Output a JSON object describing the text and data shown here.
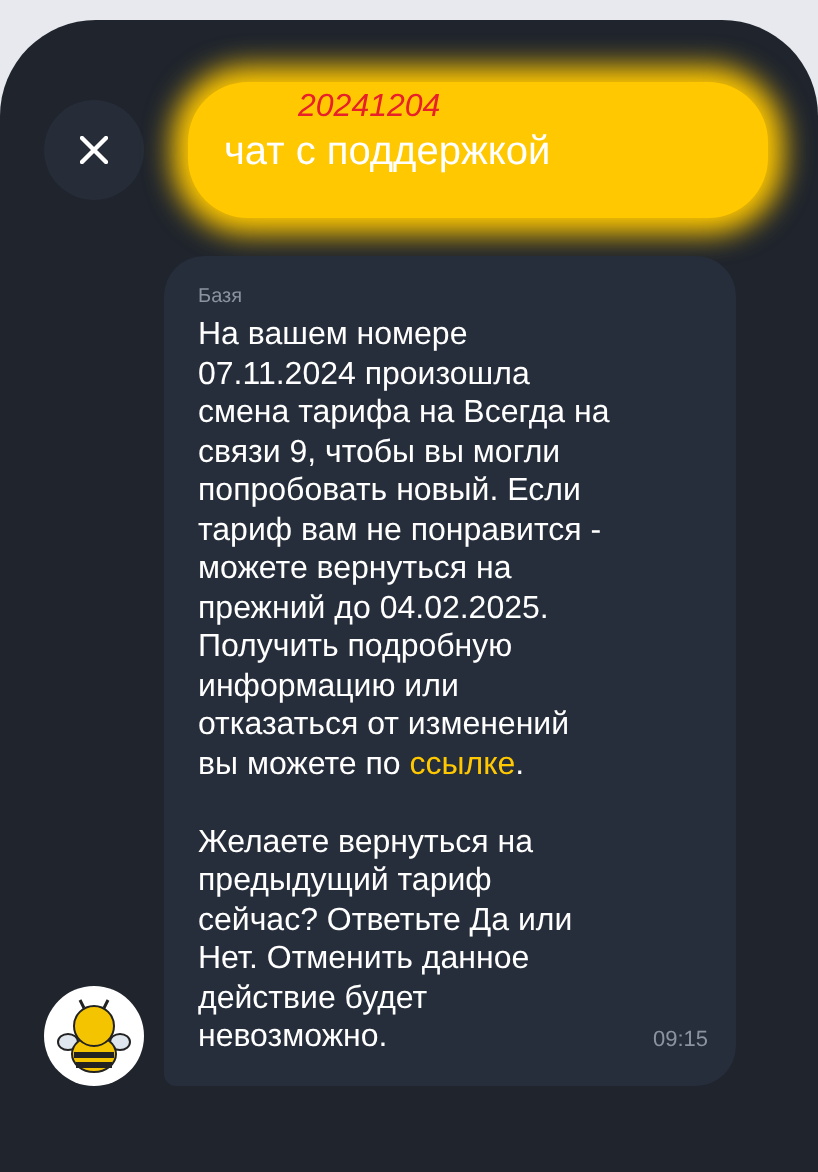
{
  "header": {
    "stamp": "20241204",
    "title": "чат с поддержкой"
  },
  "message": {
    "sender": "Базя",
    "text": "На вашем номере 07.11.2024 произошла смена тарифа на Всегда на связи 9, чтобы вы могли попробовать новый. Если тариф вам не понравится - можете вернуться на прежний до 04.02.2025. Получить подробную информацию или отказаться от изменений вы можете по",
    "link": "ссылке",
    "after": ".",
    "text2": "Желаете вернуться на предыдущий тариф сейчас? Ответьте Да или Нет. Отменить данное действие будет невозможно.",
    "time": "09:15"
  }
}
